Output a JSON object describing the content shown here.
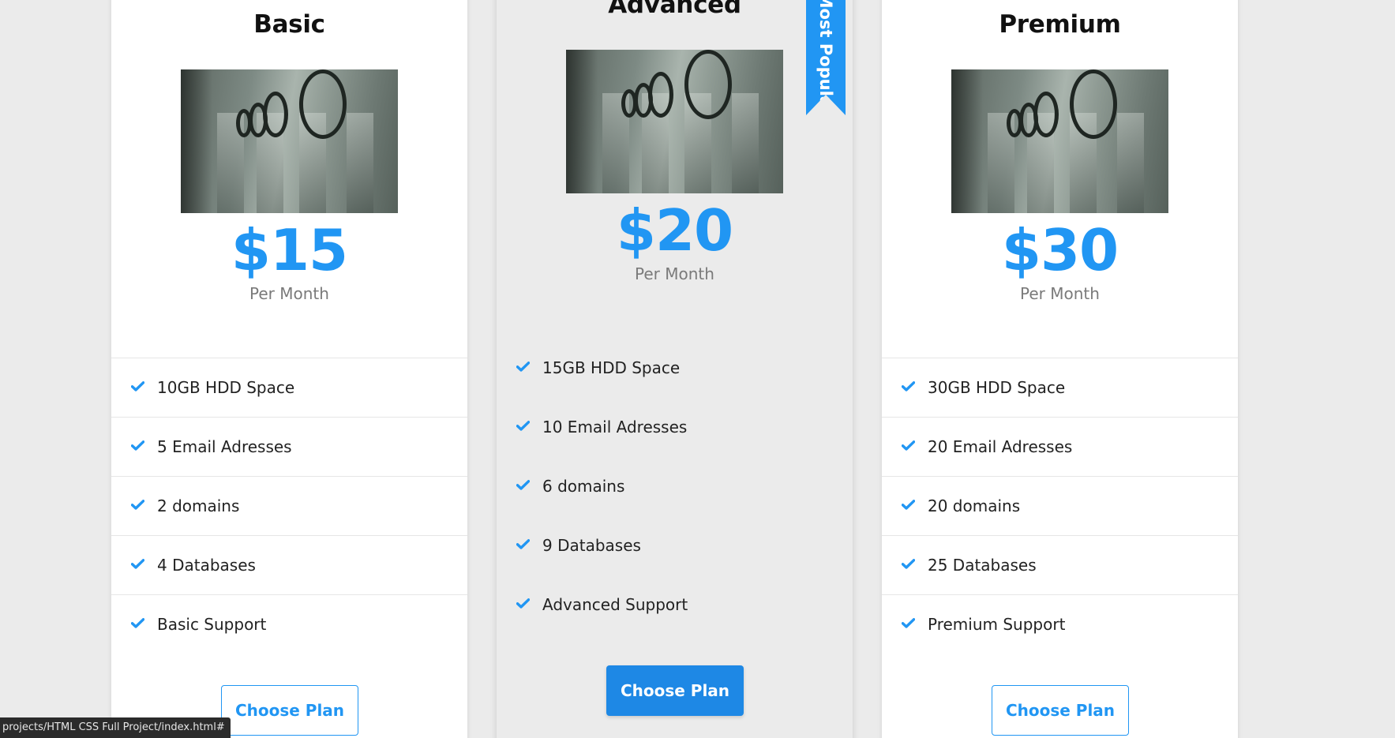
{
  "plans": [
    {
      "title": "Basic",
      "price": "$15",
      "period": "Per Month",
      "features": [
        "10GB HDD Space",
        "5 Email Adresses",
        "2 domains",
        "4 Databases",
        "Basic Support"
      ],
      "button": "Choose Plan"
    },
    {
      "title": "Advanced",
      "price": "$20",
      "period": "Per Month",
      "features": [
        "15GB HDD Space",
        "10 Email Adresses",
        "6 domains",
        "9 Databases",
        "Advanced Support"
      ],
      "button": "Choose Plan",
      "ribbon": "Most Popular"
    },
    {
      "title": "Premium",
      "price": "$30",
      "period": "Per Month",
      "features": [
        "30GB HDD Space",
        "20 Email Adresses",
        "20 domains",
        "25 Databases",
        "Premium Support"
      ],
      "button": "Choose Plan"
    }
  ],
  "status_bar": {
    "url": "projects/HTML CSS Full Project/index.html#"
  },
  "colors": {
    "accent": "#2196f3",
    "background": "#ebebeb",
    "card": "#ffffff"
  },
  "icons": {
    "feature": "check-icon",
    "plan_image": "vault-door-photo"
  }
}
